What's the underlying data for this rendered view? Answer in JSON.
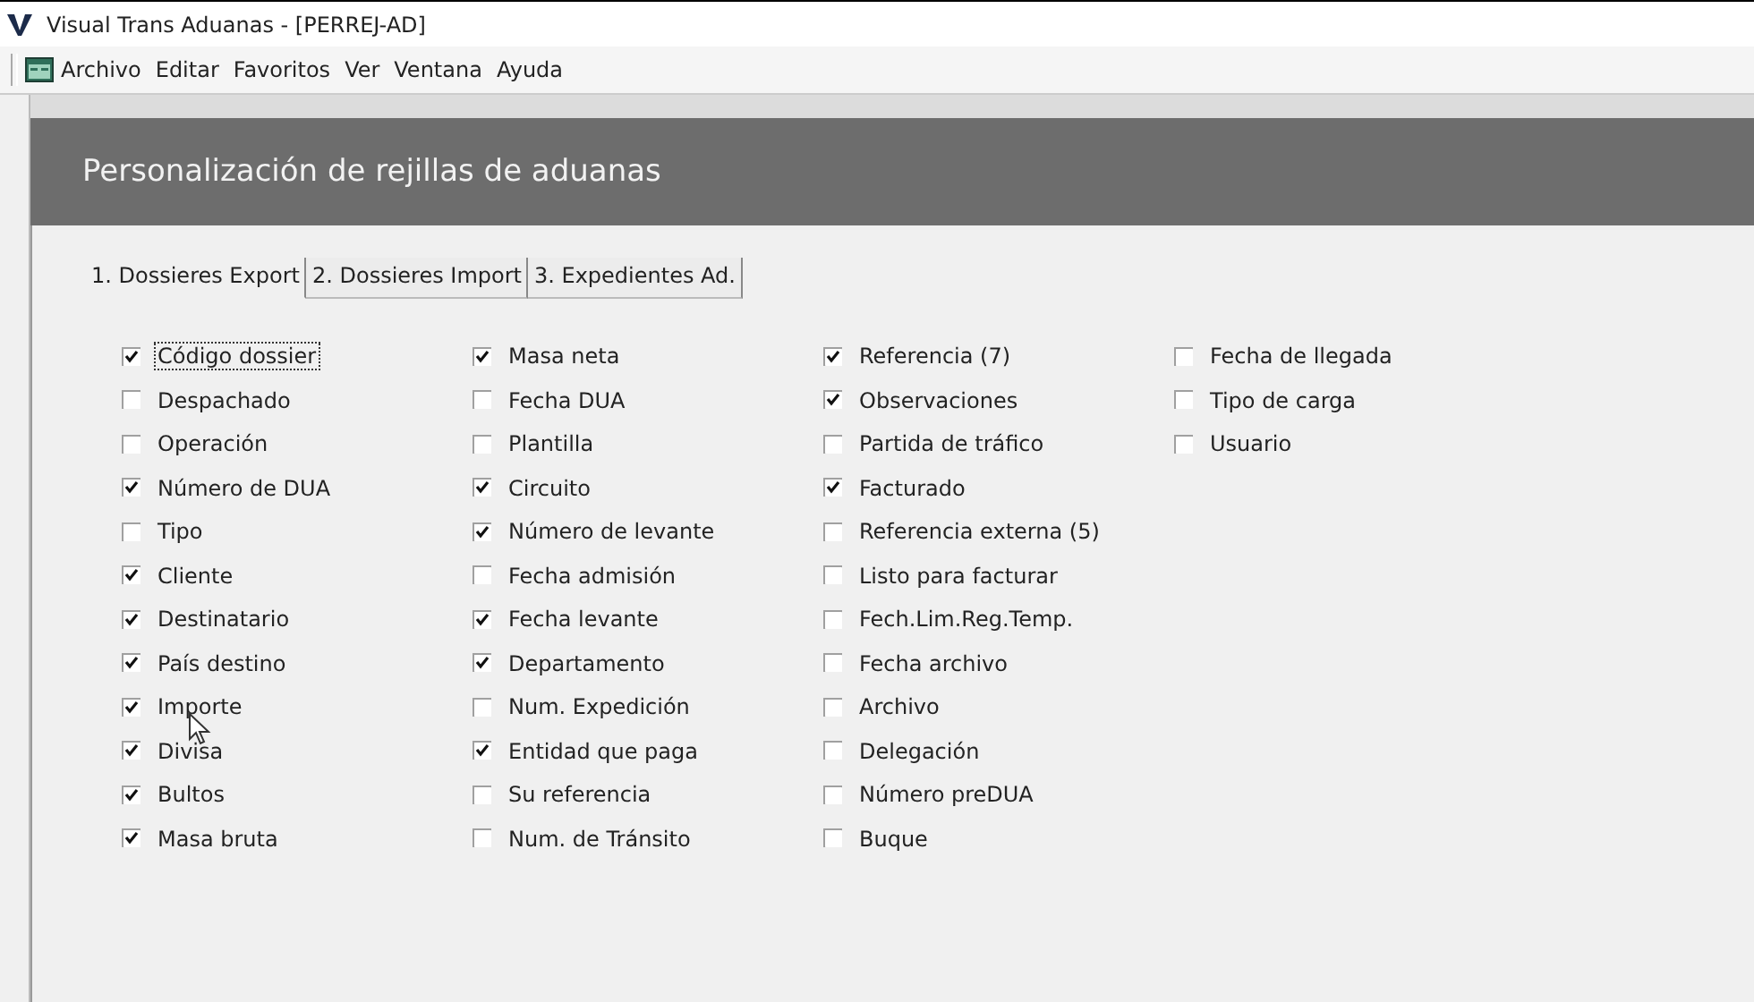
{
  "window": {
    "title": "Visual Trans Aduanas - [PERREJ-AD]"
  },
  "menu": [
    "Archivo",
    "Editar",
    "Favoritos",
    "Ver",
    "Ventana",
    "Ayuda"
  ],
  "panel": {
    "title": "Personalización de rejillas de aduanas"
  },
  "tabs": [
    {
      "label": "1. Dossieres Export",
      "selected": true
    },
    {
      "label": "2. Dossieres Import",
      "selected": false
    },
    {
      "label": "3. Expedientes Ad.",
      "selected": false
    }
  ],
  "columns": [
    {
      "items": [
        {
          "label": "Código dossier",
          "checked": true,
          "focused": true
        },
        {
          "label": "Despachado",
          "checked": false,
          "focused": false
        },
        {
          "label": "Operación",
          "checked": false,
          "focused": false
        },
        {
          "label": "Número de DUA",
          "checked": true,
          "focused": false
        },
        {
          "label": "Tipo",
          "checked": false,
          "focused": false
        },
        {
          "label": "Cliente",
          "checked": true,
          "focused": false
        },
        {
          "label": "Destinatario",
          "checked": true,
          "focused": false
        },
        {
          "label": "País destino",
          "checked": true,
          "focused": false
        },
        {
          "label": "Importe",
          "checked": true,
          "focused": false
        },
        {
          "label": "Divisa",
          "checked": true,
          "focused": false
        },
        {
          "label": "Bultos",
          "checked": true,
          "focused": false
        },
        {
          "label": "Masa bruta",
          "checked": true,
          "focused": false
        }
      ]
    },
    {
      "items": [
        {
          "label": "Masa neta",
          "checked": true,
          "focused": false
        },
        {
          "label": "Fecha DUA",
          "checked": false,
          "focused": false
        },
        {
          "label": "Plantilla",
          "checked": false,
          "focused": false
        },
        {
          "label": "Circuito",
          "checked": true,
          "focused": false
        },
        {
          "label": "Número de levante",
          "checked": true,
          "focused": false
        },
        {
          "label": "Fecha admisión",
          "checked": false,
          "focused": false
        },
        {
          "label": "Fecha levante",
          "checked": true,
          "focused": false
        },
        {
          "label": "Departamento",
          "checked": true,
          "focused": false
        },
        {
          "label": "Num. Expedición",
          "checked": false,
          "focused": false
        },
        {
          "label": "Entidad que paga",
          "checked": true,
          "focused": false
        },
        {
          "label": "Su referencia",
          "checked": false,
          "focused": false
        },
        {
          "label": "Num. de Tránsito",
          "checked": false,
          "focused": false
        }
      ]
    },
    {
      "items": [
        {
          "label": "Referencia (7)",
          "checked": true,
          "focused": false
        },
        {
          "label": "Observaciones",
          "checked": true,
          "focused": false
        },
        {
          "label": "Partida de tráfico",
          "checked": false,
          "focused": false
        },
        {
          "label": "Facturado",
          "checked": true,
          "focused": false
        },
        {
          "label": "Referencia externa (5)",
          "checked": false,
          "focused": false
        },
        {
          "label": "Listo para facturar",
          "checked": false,
          "focused": false
        },
        {
          "label": "Fech.Lim.Reg.Temp.",
          "checked": false,
          "focused": false
        },
        {
          "label": "Fecha archivo",
          "checked": false,
          "focused": false
        },
        {
          "label": "Archivo",
          "checked": false,
          "focused": false
        },
        {
          "label": "Delegación",
          "checked": false,
          "focused": false
        },
        {
          "label": "Número preDUA",
          "checked": false,
          "focused": false
        },
        {
          "label": "Buque",
          "checked": false,
          "focused": false
        }
      ]
    },
    {
      "items": [
        {
          "label": "Fecha de llegada",
          "checked": false,
          "focused": false
        },
        {
          "label": "Tipo de carga",
          "checked": false,
          "focused": false
        },
        {
          "label": "Usuario",
          "checked": false,
          "focused": false
        }
      ]
    }
  ]
}
